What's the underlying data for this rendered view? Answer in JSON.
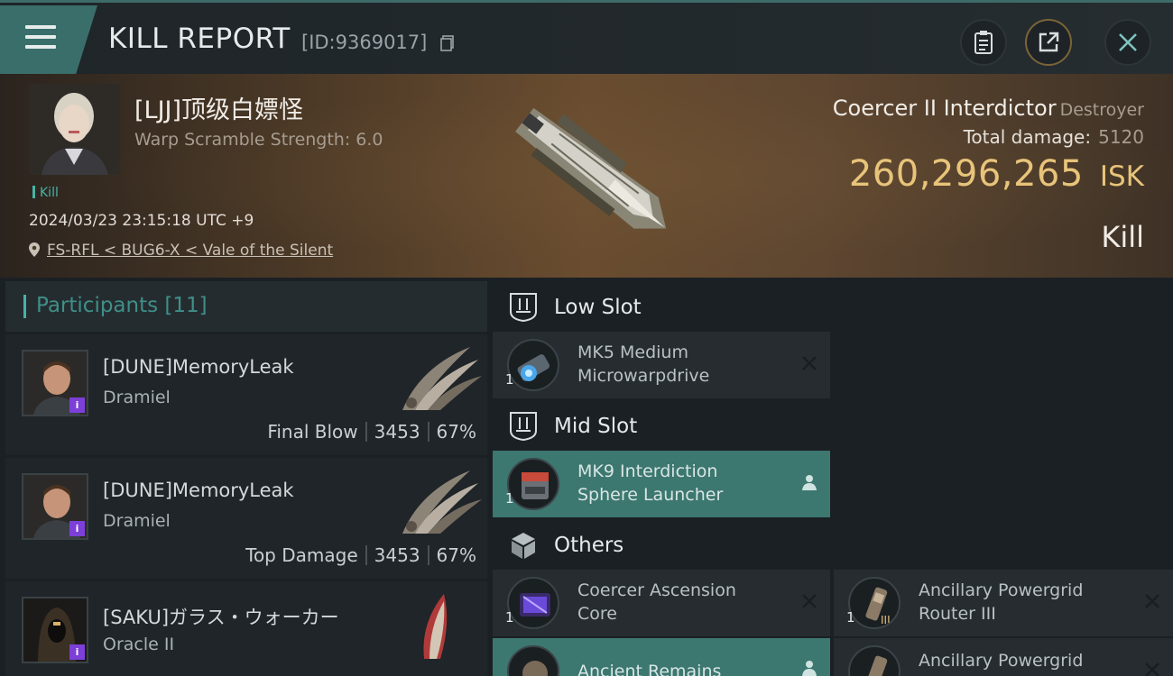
{
  "header": {
    "title": "KILL REPORT",
    "report_id": "[ID:9369017]"
  },
  "victim": {
    "name": "[LJJ]顶级白嫖怪",
    "warp_scramble": "Warp Scramble Strength: 6.0",
    "kill_tag": "Kill",
    "datetime": "2024/03/23 23:15:18 UTC +9",
    "location": "FS-RFL < BUG6-X < Vale of the Silent"
  },
  "ship": {
    "name": "Coercer II Interdictor",
    "class": "Destroyer",
    "total_damage_label": "Total damage:",
    "total_damage_value": "5120",
    "isk_amount": "260,296,265",
    "isk_unit": "ISK",
    "result": "Kill"
  },
  "participants": {
    "label": "Participants",
    "count": "[11]",
    "rows": [
      {
        "name": "[DUNE]MemoryLeak",
        "ship": "Dramiel",
        "role": "Final Blow",
        "damage": "3453",
        "percent": "67%"
      },
      {
        "name": "[DUNE]MemoryLeak",
        "ship": "Dramiel",
        "role": "Top Damage",
        "damage": "3453",
        "percent": "67%"
      },
      {
        "name": "[SAKU]ガラス・ウォーカー",
        "ship": "Oracle II",
        "role": "",
        "damage": "",
        "percent": ""
      }
    ]
  },
  "fitting": {
    "low_slot": {
      "label": "Low Slot",
      "items": [
        {
          "qty": "1",
          "name_line1": "MK5 Medium",
          "name_line2": "Microwarpdrive",
          "status": "destroyed"
        }
      ]
    },
    "mid_slot": {
      "label": "Mid Slot",
      "items": [
        {
          "qty": "1",
          "name_line1": "MK9 Interdiction",
          "name_line2": "Sphere Launcher",
          "status": "dropped"
        }
      ]
    },
    "others": {
      "label": "Others",
      "items": [
        {
          "qty": "1",
          "name_line1": "Coercer Ascension",
          "name_line2": "Core",
          "status": "destroyed"
        },
        {
          "qty": "1",
          "name_line1": "Ancillary Powergrid",
          "name_line2": "Router III",
          "status": "destroyed"
        },
        {
          "qty": "",
          "name_line1": "Ancient Remains",
          "name_line2": "",
          "status": "dropped"
        },
        {
          "qty": "",
          "name_line1": "Ancillary Powergrid",
          "name_line2": "",
          "status": "destroyed"
        }
      ]
    }
  },
  "colors": {
    "accent_teal": "#3c7770",
    "isk_gold": "#e8c47a",
    "badge_purple": "#7c3fd8"
  }
}
